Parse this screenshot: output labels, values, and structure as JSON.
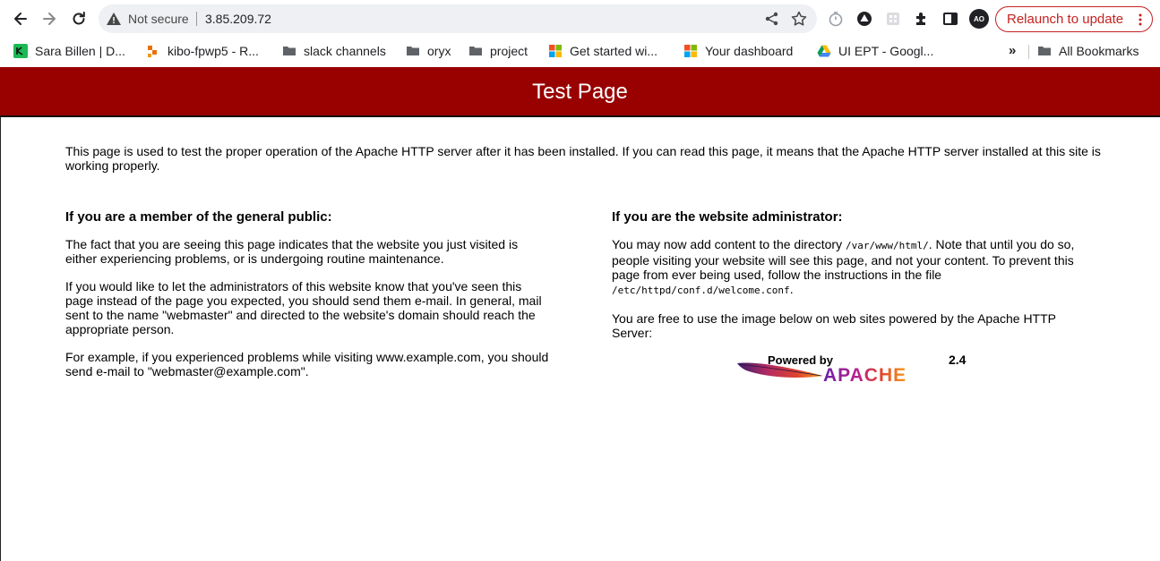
{
  "browser": {
    "omnibox": {
      "security_status": "Not secure",
      "url": "3.85.209.72"
    },
    "profile_initials": "AO",
    "relaunch_label": "Relaunch to update",
    "bookmarks": [
      {
        "label": "Sara Billen | D...",
        "icon": "site-favicon-green"
      },
      {
        "label": "kibo-fpwp5 - R...",
        "icon": "site-favicon-orange"
      },
      {
        "label": "slack channels",
        "icon": "folder-icon"
      },
      {
        "label": "oryx",
        "icon": "folder-icon"
      },
      {
        "label": "project",
        "icon": "folder-icon"
      },
      {
        "label": "Get started wi...",
        "icon": "microsoft-icon"
      },
      {
        "label": "Your dashboard",
        "icon": "microsoft-icon"
      },
      {
        "label": "UI EPT - Googl...",
        "icon": "google-drive-icon"
      }
    ],
    "bookmarks_overflow": "»",
    "all_bookmarks_label": "All Bookmarks",
    "colors": {
      "accent_red": "#c5221f",
      "omnibox_bg": "#eef0f3"
    }
  },
  "page": {
    "title": "Test Page",
    "banner_color": "#990000",
    "intro": "This page is used to test the proper operation of the Apache HTTP server after it has been installed. If you can read this page, it means that the Apache HTTP server installed at this site is working properly.",
    "public": {
      "heading": "If you are a member of the general public:",
      "p1": "The fact that you are seeing this page indicates that the website you just visited is either experiencing problems, or is undergoing routine maintenance.",
      "p2": "If you would like to let the administrators of this website know that you've seen this page instead of the page you expected, you should send them e-mail. In general, mail sent to the name \"webmaster\" and directed to the website's domain should reach the appropriate person.",
      "p3": "For example, if you experienced problems while visiting www.example.com, you should send e-mail to \"webmaster@example.com\"."
    },
    "admin": {
      "heading": "If you are the website administrator:",
      "p1_before": "You may now add content to the directory ",
      "p1_dir": "/var/www/html/",
      "p1_middle": ". Note that until you do so, people visiting your website will see this page, and not your content. To prevent this page from ever being used, follow the instructions in the file ",
      "p1_file": "/etc/httpd/conf.d/welcome.conf",
      "p1_after": ".",
      "p2": "You are free to use the image below on web sites powered by the Apache HTTP Server:"
    },
    "powered_badge": {
      "powered_by": "Powered by",
      "name": "APACHE",
      "version": "2.4"
    }
  }
}
